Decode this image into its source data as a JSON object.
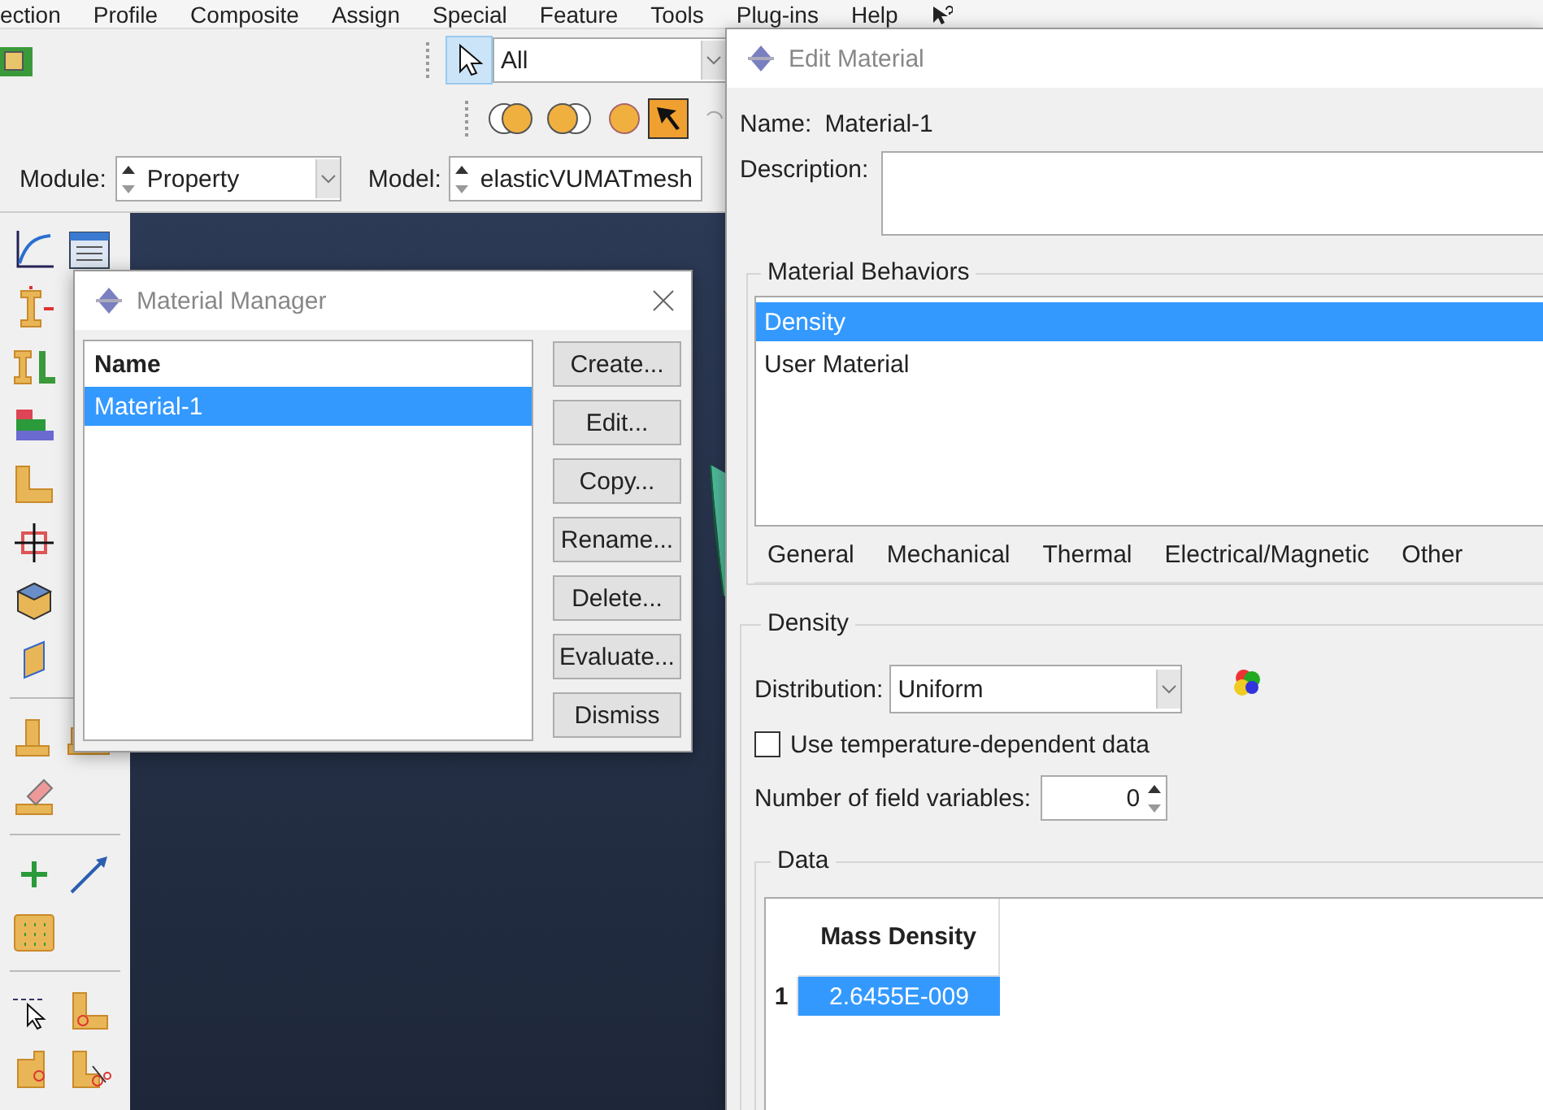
{
  "menu_bar": [
    {
      "label": "ection"
    },
    {
      "label": "Profile"
    },
    {
      "label": "Composite"
    },
    {
      "label": "Assign"
    },
    {
      "label": "Special"
    },
    {
      "label": "Feature"
    },
    {
      "label": "Tools"
    },
    {
      "label": "Plug-ins"
    },
    {
      "label": "Help"
    }
  ],
  "selection_toolbar": {
    "pick_tool_on": true,
    "filter": "All"
  },
  "module_bar": {
    "module_label": "Module:",
    "module": "Property",
    "model_label": "Model:",
    "model": "elasticVUMATmesh"
  },
  "material_manager": {
    "title": "Material Manager",
    "column": "Name",
    "rows": [
      {
        "name": "Material-1",
        "selected": true
      }
    ],
    "buttons": [
      "Create...",
      "Edit...",
      "Copy...",
      "Rename...",
      "Delete...",
      "Evaluate...",
      "Dismiss"
    ]
  },
  "edit_material": {
    "title": "Edit Material",
    "name_label": "Name:",
    "name": "Material-1",
    "description_label": "Description:",
    "behaviors_title": "Material Behaviors",
    "behaviors": [
      {
        "label": "Density",
        "selected": true
      },
      {
        "label": "User Material",
        "selected": false
      }
    ],
    "menus": [
      {
        "label": "General"
      },
      {
        "label": "Mechanical"
      },
      {
        "label": "Thermal"
      },
      {
        "label": "Electrical/Magnetic"
      },
      {
        "label": "Other"
      }
    ],
    "density_title": "Density",
    "distribution_label": "Distribution:",
    "distribution": "Uniform",
    "temperature_checkbox": {
      "label": "Use temperature-dependent data",
      "checked": false
    },
    "field_variables_label": "Number of field variables:",
    "field_variables": "0",
    "data_title": "Data",
    "table": {
      "columns": [
        "Mass Density"
      ],
      "rows": [
        {
          "index": "1",
          "cells": [
            "2.6455E-009"
          ],
          "selected": true
        }
      ]
    }
  }
}
